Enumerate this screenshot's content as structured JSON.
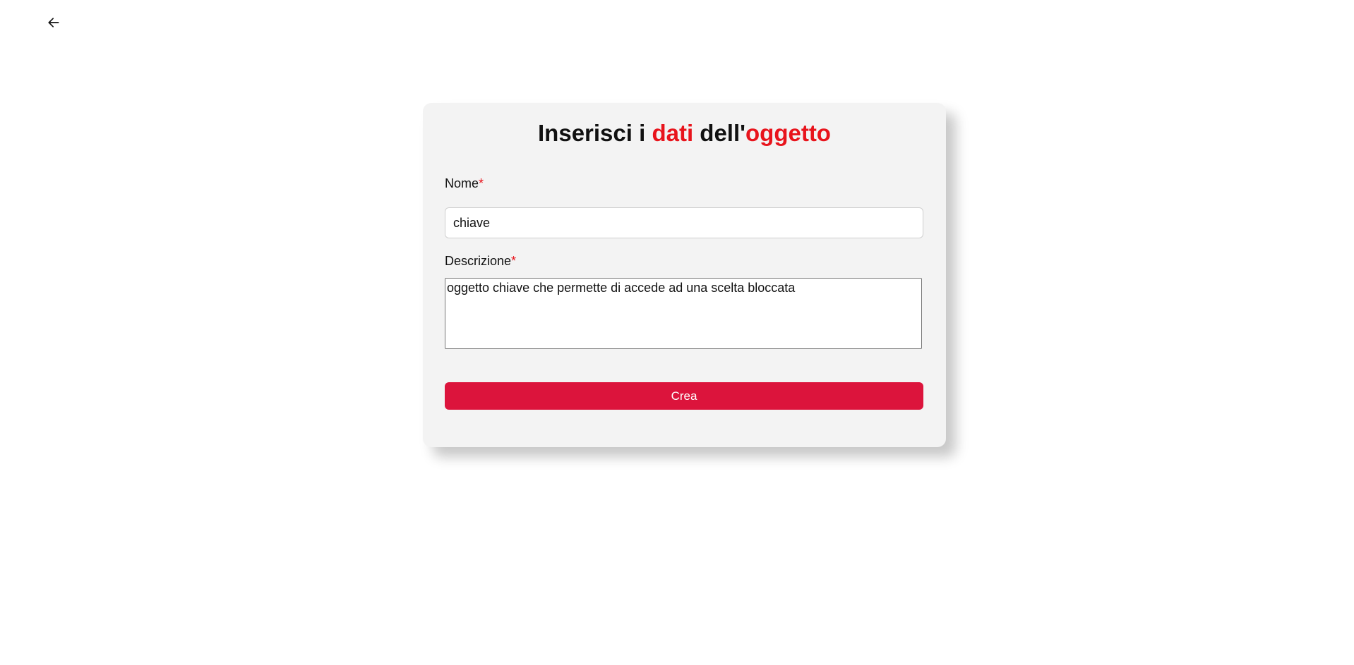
{
  "nav": {
    "back_icon": "arrow-left-icon"
  },
  "form": {
    "title": {
      "part1": "Inserisci i ",
      "part2": "dati",
      "part3": " dell'",
      "part4": "oggetto"
    },
    "accent_color": "#e8141c",
    "button_color": "#dc143c",
    "name": {
      "label": "Nome",
      "required_mark": "*",
      "value": "chiave"
    },
    "description": {
      "label": "Descrizione",
      "required_mark": "*",
      "value": "oggetto chiave che permette di accede ad una scelta bloccata"
    },
    "submit_label": "Crea"
  }
}
